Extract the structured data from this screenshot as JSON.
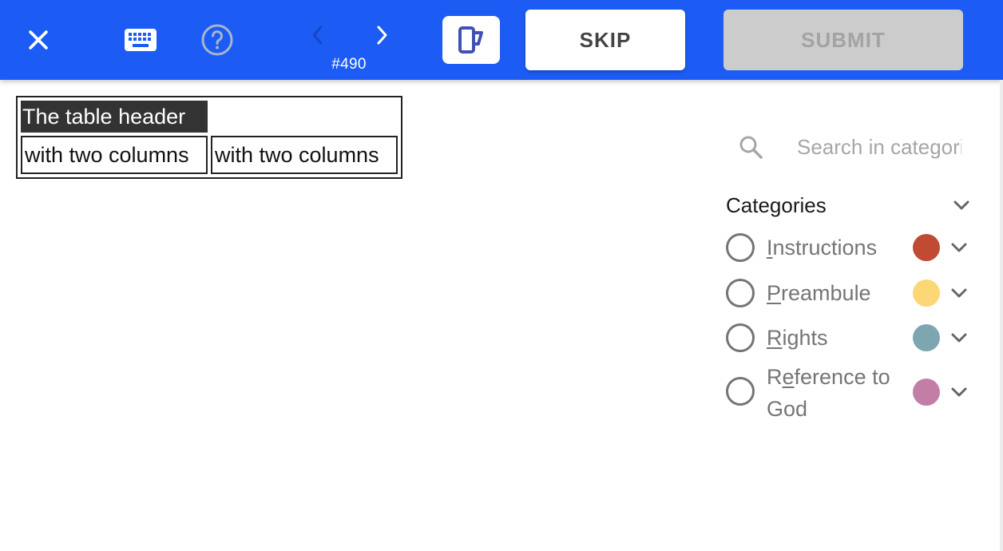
{
  "toolbar": {
    "task_id": "#490",
    "skip_label": "SKIP",
    "submit_label": "SUBMIT",
    "colors": {
      "bar": "#1c5cf5",
      "mug_icon": "#3f51b5"
    },
    "icons": [
      "close-icon",
      "keyboard-icon",
      "help-icon",
      "chevron-left-icon",
      "chevron-right-icon",
      "mug-icon"
    ]
  },
  "document": {
    "header": "The table header",
    "cells": [
      "with two columns",
      "with two columns"
    ]
  },
  "panel": {
    "search": {
      "placeholder": "Search in categories"
    },
    "categories_title": "Categories",
    "categories": [
      {
        "underline": "I",
        "rest": "nstructions",
        "color": "#c14a32"
      },
      {
        "underline": "P",
        "rest": "reambule",
        "color": "#fbd776"
      },
      {
        "underline": "R",
        "rest": "ights",
        "color": "#7ea6b1"
      },
      {
        "pre": "R",
        "underline": "e",
        "rest": "ference to God",
        "color": "#c27ea6"
      }
    ]
  }
}
